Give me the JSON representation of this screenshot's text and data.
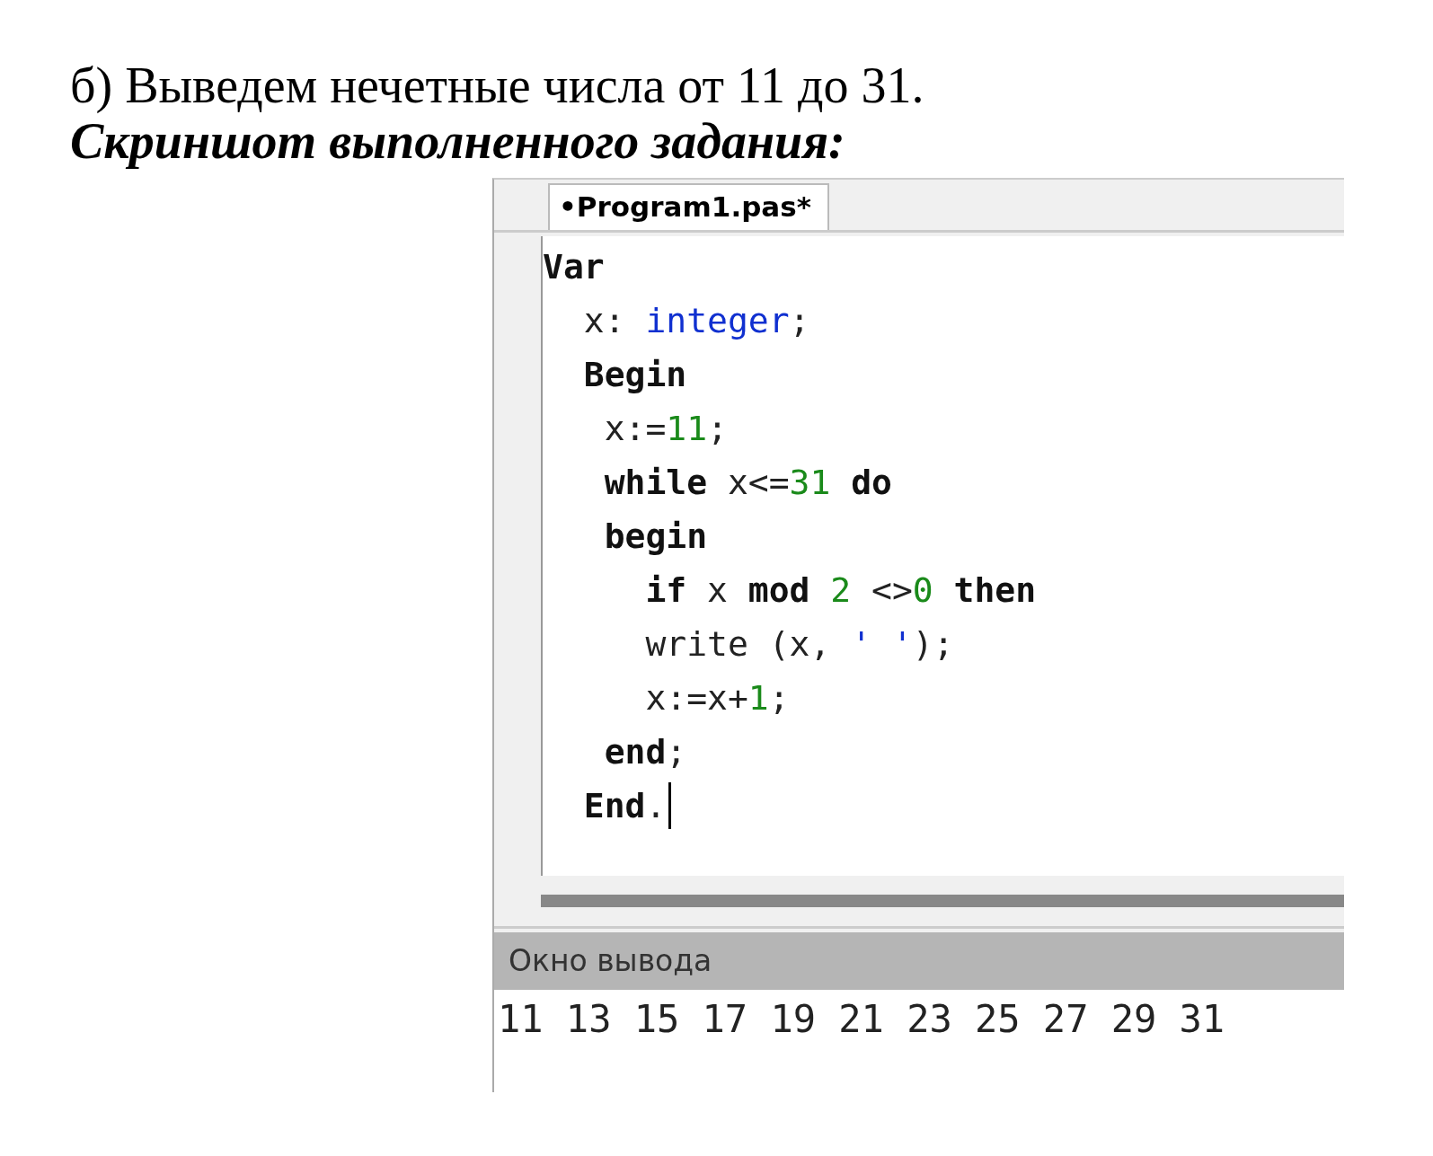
{
  "heading": "б) Выведем нечетные числа от 11 до 31.",
  "subheading": "Скриншот выполненного задания:",
  "editor": {
    "tab": {
      "label": "•Program1.pas*",
      "selected": true
    },
    "lines": [
      {
        "tokens": [
          {
            "kind": "kw",
            "text": "Var"
          }
        ]
      },
      {
        "tokens": [
          {
            "kind": "plain",
            "text": "  x: "
          },
          {
            "kind": "type",
            "text": "integer"
          },
          {
            "kind": "plain",
            "text": ";"
          }
        ]
      },
      {
        "tokens": [
          {
            "kind": "kw",
            "text": "  Begin"
          }
        ]
      },
      {
        "tokens": [
          {
            "kind": "plain",
            "text": "   x:="
          },
          {
            "kind": "num",
            "text": "11"
          },
          {
            "kind": "plain",
            "text": ";"
          }
        ]
      },
      {
        "tokens": [
          {
            "kind": "kw",
            "text": "   while"
          },
          {
            "kind": "plain",
            "text": " x<="
          },
          {
            "kind": "num",
            "text": "31"
          },
          {
            "kind": "kw",
            "text": " do"
          }
        ]
      },
      {
        "tokens": [
          {
            "kind": "kw",
            "text": "   begin"
          }
        ]
      },
      {
        "tokens": [
          {
            "kind": "kw",
            "text": "     if"
          },
          {
            "kind": "plain",
            "text": " x "
          },
          {
            "kind": "kw",
            "text": "mod"
          },
          {
            "kind": "num",
            "text": " 2"
          },
          {
            "kind": "plain",
            "text": " <>"
          },
          {
            "kind": "num",
            "text": "0"
          },
          {
            "kind": "kw",
            "text": " then"
          }
        ]
      },
      {
        "tokens": [
          {
            "kind": "plain",
            "text": "     write (x, "
          },
          {
            "kind": "str",
            "text": "' '"
          },
          {
            "kind": "plain",
            "text": ");"
          }
        ]
      },
      {
        "tokens": [
          {
            "kind": "plain",
            "text": "     x:=x+"
          },
          {
            "kind": "num",
            "text": "1"
          },
          {
            "kind": "plain",
            "text": ";"
          }
        ]
      },
      {
        "tokens": [
          {
            "kind": "kw",
            "text": "   end"
          },
          {
            "kind": "plain",
            "text": ";"
          }
        ]
      },
      {
        "tokens": [
          {
            "kind": "kw",
            "text": "  End"
          },
          {
            "kind": "plain",
            "text": "."
          }
        ]
      }
    ]
  },
  "output": {
    "title": "Окно вывода",
    "text": "11 13 15 17 19 21 23 25 27 29 31"
  }
}
